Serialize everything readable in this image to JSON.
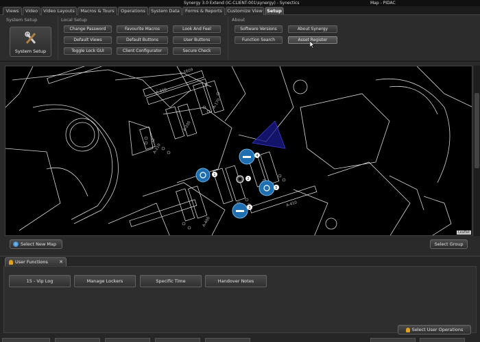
{
  "window": {
    "title": "Synergy 3.0 Extend (IC-CLIENT-001\\synergy) - Synectics",
    "map_title": "Map - PIDAC"
  },
  "tabs": [
    {
      "label": "Views"
    },
    {
      "label": "Video"
    },
    {
      "label": "Video Layouts"
    },
    {
      "label": "Macros & Tours"
    },
    {
      "label": "Operations"
    },
    {
      "label": "System Data"
    },
    {
      "label": "Forms & Reports"
    },
    {
      "label": "Customize View"
    },
    {
      "label": "Setup",
      "active": true
    }
  ],
  "ribbon": {
    "system_setup": {
      "label": "System Setup",
      "button": "System Setup"
    },
    "local_setup": {
      "label": "Local Setup",
      "buttons": [
        "Change Password",
        "Favourite Macros",
        "Look And Feel",
        "Default Views",
        "Default Buttons",
        "User Buttons",
        "Toggle Lock GUI",
        "Client Configurator",
        "Secure Check"
      ]
    },
    "about": {
      "label": "About",
      "buttons": [
        "Software Versions",
        "About Synergy",
        "Function Search",
        "Asset Register"
      ]
    }
  },
  "map": {
    "select_new_map": "Select New Map",
    "select_group": "Select Group",
    "attribution": "Leaflet",
    "room_labels": [
      "A-1609",
      "A-210",
      "A-170",
      "A-205",
      "A-136",
      "A-330",
      "A-400",
      "A-410",
      "A-310"
    ],
    "markers": [
      {
        "id": "1",
        "icon": "dome-camera-icon"
      },
      {
        "id": "2",
        "icon": "gear-icon"
      },
      {
        "id": "3",
        "icon": "fixed-camera-icon"
      },
      {
        "id": "4",
        "icon": "fixed-camera-icon"
      },
      {
        "id": "5",
        "icon": "dome-camera-icon"
      }
    ],
    "accent_color": "#1f6fb0",
    "fov_color": "#1a1a8c"
  },
  "functions_panel": {
    "tab_label": "User Functions",
    "buttons": [
      "15 - Vip Log",
      "Manage Lockers",
      "Specific Time",
      "Handover Notes"
    ],
    "select_user_operations": "Select User Operations"
  }
}
